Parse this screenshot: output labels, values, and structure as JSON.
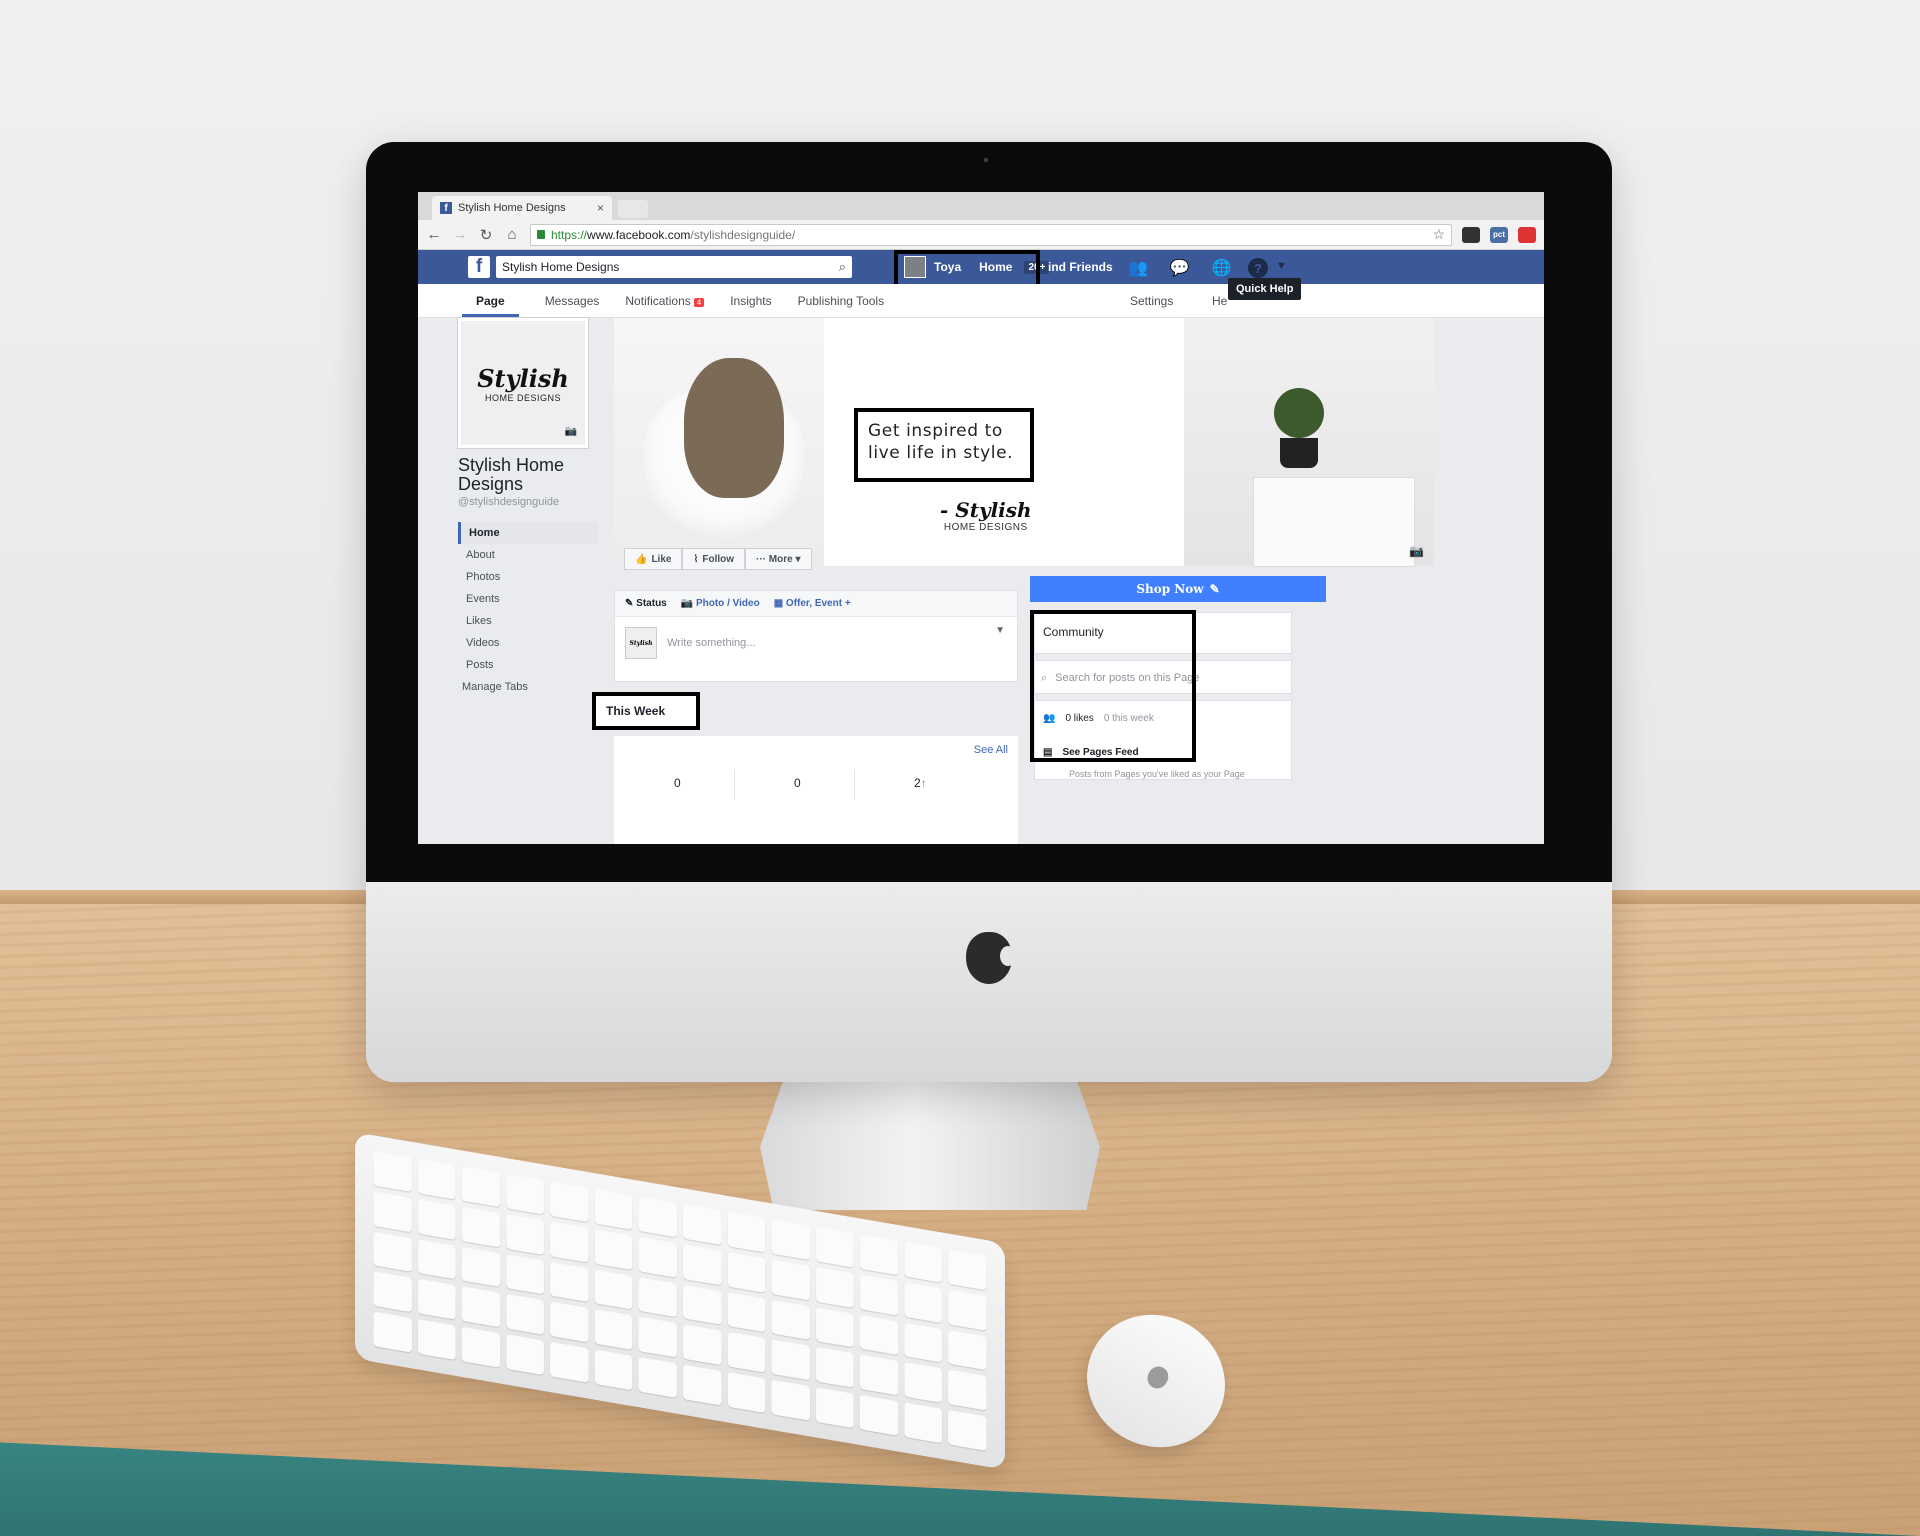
{
  "browser": {
    "tab_title": "Stylish Home Designs",
    "tab_close": "×",
    "url_secure": "https://",
    "url_host": "www.facebook.com",
    "url_path": "/stylishdesignguide/",
    "nav_back": "←",
    "nav_forward": "→",
    "nav_reload": "↻",
    "nav_home": "⌂",
    "star": "☆",
    "extensions": [
      "owl",
      "pct",
      "red"
    ],
    "ext_pct_label": "pct"
  },
  "fb_header": {
    "logo": "f",
    "search_value": "Stylish Home Designs",
    "user_name": "Toya",
    "home_label": "Home",
    "home_badge": "20+",
    "find_friends": "ind Friends",
    "quick_help": "Quick Help",
    "help_glyph": "?"
  },
  "page_tabs": {
    "page": "Page",
    "messages": "Messages",
    "notifications": "Notifications",
    "notifications_badge": "4",
    "insights": "Insights",
    "publishing_tools": "Publishing Tools",
    "settings": "Settings",
    "help": "He"
  },
  "profile": {
    "pic_script": "Stylish",
    "pic_sub": "HOME DESIGNS",
    "name": "Stylish Home Designs",
    "handle": "@stylishdesignguide"
  },
  "sidebar": {
    "items": [
      {
        "label": "Home",
        "active": true
      },
      {
        "label": "About"
      },
      {
        "label": "Photos"
      },
      {
        "label": "Events"
      },
      {
        "label": "Likes"
      },
      {
        "label": "Videos"
      },
      {
        "label": "Posts"
      },
      {
        "label": "Manage Tabs"
      }
    ]
  },
  "cover": {
    "quote": "Get inspired to live life in style.",
    "sign": "- Stylish",
    "sign_sub": "HOME DESIGNS"
  },
  "actions": {
    "like": "Like",
    "follow": "Follow",
    "more": "··· More ▾",
    "shop_now": "Shop Now"
  },
  "composer": {
    "status": "Status",
    "photo_video": "Photo / Video",
    "offer_event": "Offer, Event +",
    "placeholder": "Write something...",
    "avatar_text": "Stylish"
  },
  "this_week": {
    "title": "This Week",
    "see_all": "See All",
    "stats": [
      "0",
      "0",
      "2"
    ]
  },
  "community": {
    "title": "Community",
    "search_placeholder": "Search for posts on this Page",
    "likes": "0 likes",
    "likes_sub": "0 this week",
    "see_pages_feed": "See Pages Feed",
    "feed_sub": "Posts from Pages you've liked as your Page"
  },
  "colors": {
    "fb_blue": "#3b5998",
    "shop_now": "#4080ff",
    "notif_red": "#fa3e3e"
  }
}
